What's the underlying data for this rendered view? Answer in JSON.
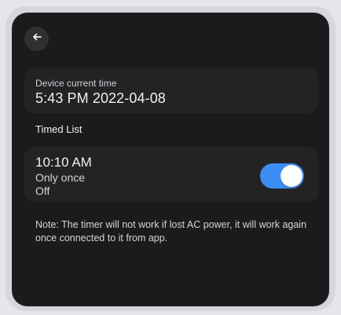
{
  "navigation": {
    "back_icon": "arrow-left-icon"
  },
  "device_time": {
    "label": "Device current time",
    "value": "5:43 PM 2022-04-08"
  },
  "timed_list": {
    "title": "Timed List",
    "items": [
      {
        "time": "10:10 AM",
        "repeat": "Only once",
        "action": "Off",
        "enabled": true
      }
    ]
  },
  "note": {
    "text": "Note: The timer will not work if lost AC power, it will work again once connected to it from app."
  },
  "colors": {
    "background": "#1b1b1d",
    "card": "#232326",
    "toggle_on": "#3d8ef4",
    "text_primary": "#f1f1f3"
  }
}
